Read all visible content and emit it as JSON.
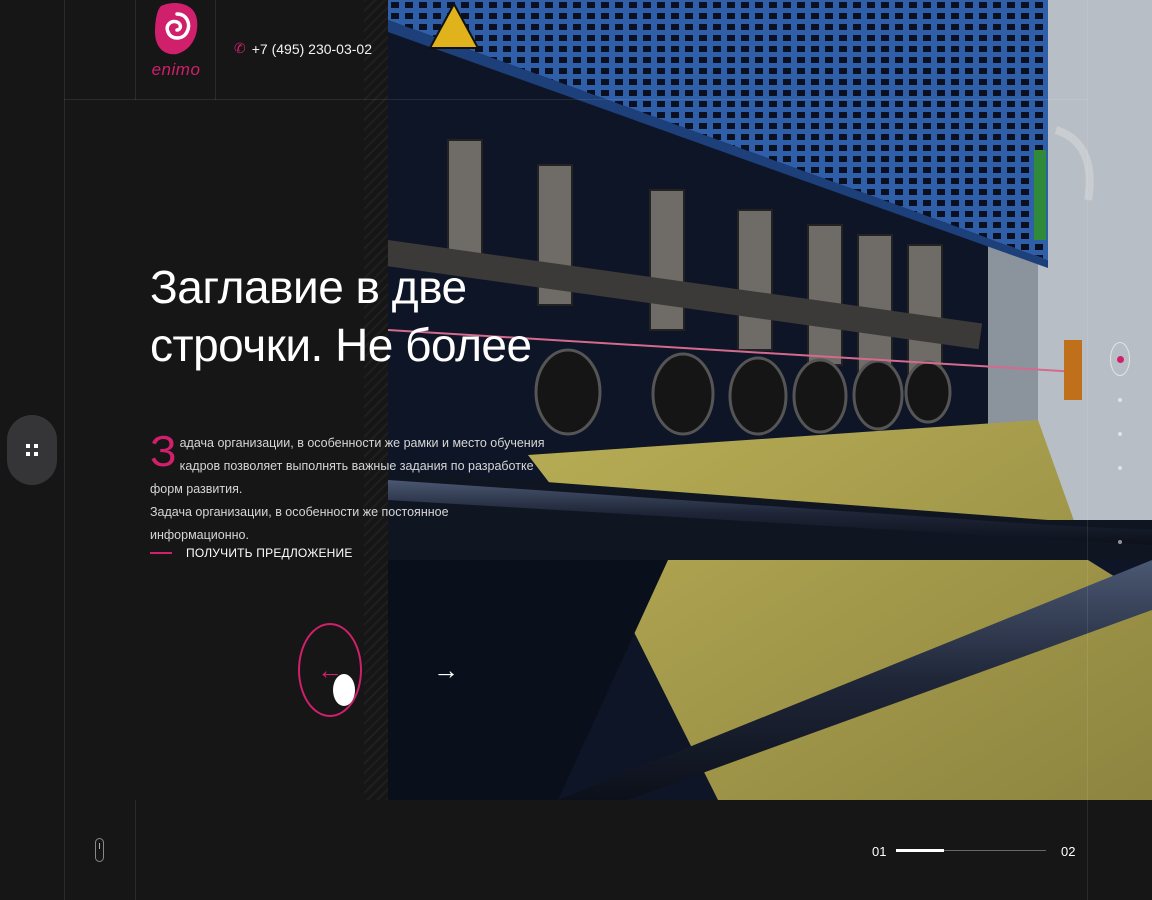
{
  "header": {
    "logo_text": "enimo",
    "phone": "+7 (495) 230-03-02"
  },
  "hero": {
    "title_line1": "Заглавие в две",
    "title_line2": "строчки. Не более",
    "dropcap": "З",
    "description_first": "адача организации, в особенности же рамки и место обучения кадров позволяет выполнять важные задания по разработке форм развития.",
    "description_second": "Задача организации, в особенности же постоянное информационно.",
    "cta_label": "ПОЛУЧИТЬ ПРЕДЛОЖЕНИЕ"
  },
  "slider": {
    "current": "01",
    "total": "02",
    "progress": 0.32
  },
  "side_pager": {
    "count": 5,
    "active": 1
  },
  "colors": {
    "accent": "#d01f6b",
    "background": "#151516"
  }
}
